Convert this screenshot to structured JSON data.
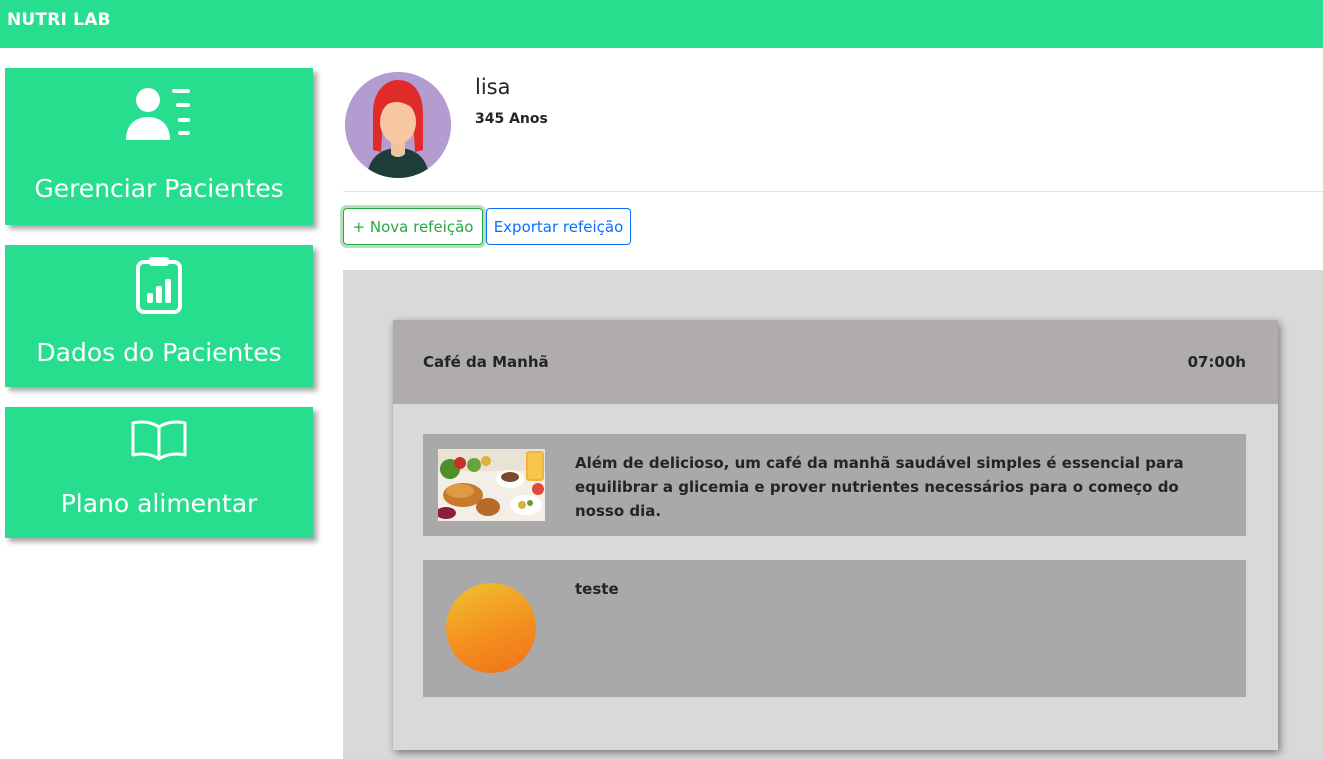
{
  "app": {
    "brand": "NUTRI LAB"
  },
  "sidebar": {
    "items": [
      {
        "label": "Gerenciar Pacientes",
        "icon": "patients-list-icon"
      },
      {
        "label": "Dados do Pacientes",
        "icon": "clipboard-chart-icon"
      },
      {
        "label": "Plano alimentar",
        "icon": "open-book-icon"
      }
    ]
  },
  "patient": {
    "name": "lisa",
    "age": "345 Anos",
    "avatar": "female-avatar-red-hair"
  },
  "actions": {
    "new_meal": "+ Nova refeição",
    "export_meal": "Exportar refeição"
  },
  "meal": {
    "title": "Café da Manhã",
    "time": "07:00h",
    "items": [
      {
        "image": "breakfast-photo",
        "text": "Além de delicioso, um café da manhã saudável simples é essencial para equilibrar a glicemia e prover nutrientes necessários para o começo do nosso dia."
      },
      {
        "image": "orange-circle",
        "text": "teste"
      }
    ]
  },
  "colors": {
    "brand_green": "#26de8e",
    "success": "#28a745",
    "primary": "#0d6efd",
    "meal_header": "#b0acab",
    "item_bg": "#a9a9a9",
    "area_bg": "#d9d9d9"
  }
}
